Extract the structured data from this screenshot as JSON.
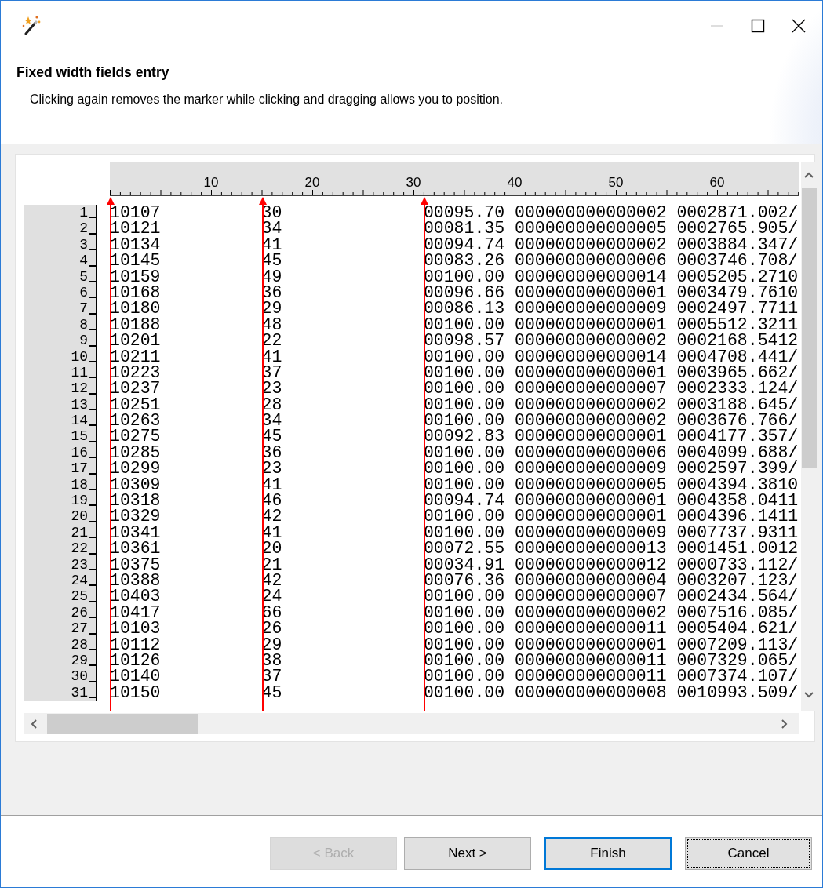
{
  "window_controls": [
    {
      "kind": "minimize",
      "disabled": true
    },
    {
      "kind": "maximize",
      "disabled": false
    },
    {
      "kind": "close",
      "disabled": false
    }
  ],
  "header": {
    "title": "Fixed width fields entry",
    "description": "Clicking again removes the marker while clicking and dragging allows you to position."
  },
  "ruler": {
    "labels": [
      "10",
      "20",
      "30",
      "40",
      "50",
      "60"
    ]
  },
  "rows": [
    {
      "number": "1",
      "fields": [
        "10107          ",
        "30              ",
        "00095.70 000000000000002 0002871.002/"
      ]
    },
    {
      "number": "2",
      "fields": [
        "10121",
        "34",
        "00081.35 000000000000005 0002765.905/"
      ]
    },
    {
      "number": "3",
      "fields": [
        "10134",
        "41",
        "00094.74 000000000000002 0003884.347/"
      ]
    },
    {
      "number": "4",
      "fields": [
        "10145",
        "45",
        "00083.26 000000000000006 0003746.708/"
      ]
    },
    {
      "number": "5",
      "fields": [
        "10159",
        "49",
        "00100.00 000000000000014 0005205.2710"
      ]
    },
    {
      "number": "6",
      "fields": [
        "10168",
        "36",
        "00096.66 000000000000001 0003479.7610"
      ]
    },
    {
      "number": "7",
      "fields": [
        "10180",
        "29",
        "00086.13 000000000000009 0002497.7711"
      ]
    },
    {
      "number": "8",
      "fields": [
        "10188",
        "48",
        "00100.00 000000000000001 0005512.3211"
      ]
    },
    {
      "number": "9",
      "fields": [
        "10201",
        "22",
        "00098.57 000000000000002 0002168.5412"
      ]
    },
    {
      "number": "10",
      "fields": [
        "10211",
        "41",
        "00100.00 000000000000014 0004708.441/"
      ]
    },
    {
      "number": "11",
      "fields": [
        "10223",
        "37",
        "00100.00 000000000000001 0003965.662/"
      ]
    },
    {
      "number": "12",
      "fields": [
        "10237",
        "23",
        "00100.00 000000000000007 0002333.124/"
      ]
    },
    {
      "number": "13",
      "fields": [
        "10251",
        "28",
        "00100.00 000000000000002 0003188.645/"
      ]
    },
    {
      "number": "14",
      "fields": [
        "10263",
        "34",
        "00100.00 000000000000002 0003676.766/"
      ]
    },
    {
      "number": "15",
      "fields": [
        "10275",
        "45",
        "00092.83 000000000000001 0004177.357/"
      ]
    },
    {
      "number": "16",
      "fields": [
        "10285",
        "36",
        "00100.00 000000000000006 0004099.688/"
      ]
    },
    {
      "number": "17",
      "fields": [
        "10299",
        "23",
        "00100.00 000000000000009 0002597.399/"
      ]
    },
    {
      "number": "18",
      "fields": [
        "10309",
        "41",
        "00100.00 000000000000005 0004394.3810"
      ]
    },
    {
      "number": "19",
      "fields": [
        "10318",
        "46",
        "00094.74 000000000000001 0004358.0411"
      ]
    },
    {
      "number": "20",
      "fields": [
        "10329",
        "42",
        "00100.00 000000000000001 0004396.1411"
      ]
    },
    {
      "number": "21",
      "fields": [
        "10341",
        "41",
        "00100.00 000000000000009 0007737.9311"
      ]
    },
    {
      "number": "22",
      "fields": [
        "10361",
        "20",
        "00072.55 000000000000013 0001451.0012"
      ]
    },
    {
      "number": "23",
      "fields": [
        "10375",
        "21",
        "00034.91 000000000000012 0000733.112/"
      ]
    },
    {
      "number": "24",
      "fields": [
        "10388",
        "42",
        "00076.36 000000000000004 0003207.123/"
      ]
    },
    {
      "number": "25",
      "fields": [
        "10403",
        "24",
        "00100.00 000000000000007 0002434.564/"
      ]
    },
    {
      "number": "26",
      "fields": [
        "10417",
        "66",
        "00100.00 000000000000002 0007516.085/"
      ]
    },
    {
      "number": "27",
      "fields": [
        "10103",
        "26",
        "00100.00 000000000000011 0005404.621/"
      ]
    },
    {
      "number": "28",
      "fields": [
        "10112",
        "29",
        "00100.00 000000000000001 0007209.113/"
      ]
    },
    {
      "number": "29",
      "fields": [
        "10126",
        "38",
        "00100.00 000000000000011 0007329.065/"
      ]
    },
    {
      "number": "30",
      "fields": [
        "10140",
        "37",
        "00100.00 000000000000011 0007374.107/"
      ]
    },
    {
      "number": "31",
      "fields": [
        "10150",
        "45",
        "00100.00 000000000000008 0010993.509/"
      ]
    }
  ],
  "buttons": [
    {
      "label": "< Back",
      "disabled": true,
      "default": false,
      "focused": false
    },
    {
      "label": "Next >",
      "disabled": false,
      "default": false,
      "focused": false
    },
    {
      "label": "Finish",
      "disabled": false,
      "default": true,
      "focused": false
    },
    {
      "label": "Cancel",
      "disabled": false,
      "default": false,
      "focused": true
    }
  ]
}
